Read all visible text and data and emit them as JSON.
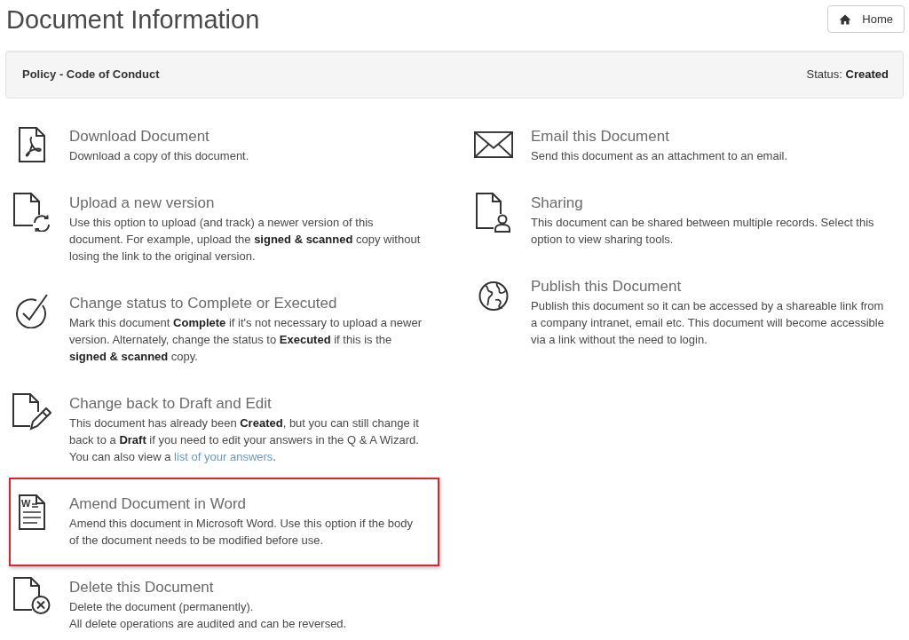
{
  "header": {
    "title": "Document Information",
    "home_button": {
      "label": "Home"
    }
  },
  "document_bar": {
    "name": "Policy - Code of Conduct",
    "status": "Status: **Created**"
  },
  "actions_left": [
    {
      "kind": "download",
      "title": "Download Document",
      "description": "Download a copy of this document.",
      "highlighted": false
    },
    {
      "kind": "upload",
      "title": "Upload a new version",
      "description": "Use this option to upload (and track) a newer version of this document. For example, upload the **signed & scanned** copy without losing the link to the original version.",
      "highlighted": false
    },
    {
      "kind": "complete",
      "title": "Change status to Complete or Executed",
      "description": "Mark this document **Complete** if it's not necessary to upload a newer version. Alternately, change the status to **Executed** if this is the **signed & scanned** copy.",
      "highlighted": false
    },
    {
      "kind": "draft",
      "title": "Change back to Draft and Edit",
      "description": "This document has already been **Created**, but you can still change it back to a **Draft** if you need to edit your answers in the Q & A Wizard. You can also view a",
      "link": "list of your answers",
      "description_after": ".",
      "highlighted": false
    },
    {
      "kind": "word",
      "icon_label": "W",
      "title": "Amend Document in Word",
      "description": "Amend this document in Microsoft Word. Use this option if the body of the document needs to be modified before use.",
      "highlighted": true
    },
    {
      "kind": "delete",
      "title": "Delete this Document",
      "description": "Delete the document (permanently).\nAll delete operations are audited and can be reversed.",
      "highlighted": false
    }
  ],
  "actions_right": [
    {
      "kind": "email",
      "title": "Email this Document",
      "description": "Send this document as an attachment to an email.",
      "highlighted": false
    },
    {
      "kind": "sharing",
      "title": "Sharing",
      "description": "This document can be shared between multiple records. Select this option to view sharing tools.",
      "highlighted": false
    },
    {
      "kind": "publish",
      "title": "Publish this Document",
      "description": "Publish this document so it can be accessed by a shareable link from a company intranet, email etc. This document will become accessible via a link without the need to login.",
      "highlighted": false
    }
  ]
}
